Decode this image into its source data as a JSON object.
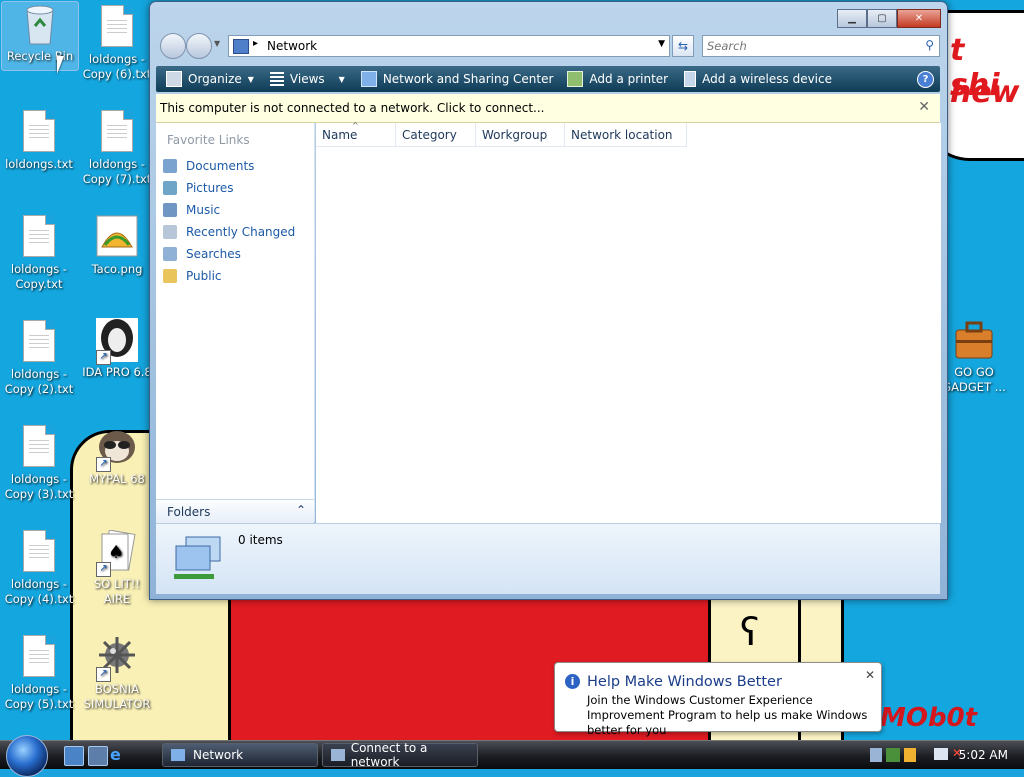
{
  "desktop": {
    "icons": [
      {
        "label": "Recycle Bin"
      },
      {
        "label": "loldongs - Copy (6).txt"
      },
      {
        "label": "loldongs.txt"
      },
      {
        "label": "loldongs - Copy (7).txt"
      },
      {
        "label": "loldongs - Copy.txt"
      },
      {
        "label": "Taco.png"
      },
      {
        "label": "loldongs - Copy (2).txt"
      },
      {
        "label": "IDA PRO 6.8"
      },
      {
        "label": "loldongs - Copy (3).txt"
      },
      {
        "label": "MYPAL 68"
      },
      {
        "label": "loldongs - Copy (4).txt"
      },
      {
        "label": "SO LIT!! AIRE"
      },
      {
        "label": "loldongs - Copy (5).txt"
      },
      {
        "label": "BOSNIA SIMULATOR"
      },
      {
        "label": "GO GO GADGET ..."
      }
    ],
    "wallpaper_text": [
      "t shi",
      "hew",
      "MOb0t"
    ],
    "colors": {
      "sky": "#14a6df",
      "red": "#e11b22",
      "sand": "#f9f0b5"
    }
  },
  "window": {
    "address": "Network",
    "search_placeholder": "Search",
    "toolbar": {
      "organize": "Organize",
      "views": "Views",
      "network_sharing": "Network and Sharing Center",
      "add_printer": "Add a printer",
      "add_wireless": "Add a wireless device"
    },
    "infobar": "This computer is not connected to a network. Click to connect...",
    "favorite_links_header": "Favorite Links",
    "favorite_links": [
      {
        "label": "Documents",
        "icon": "documents-icon"
      },
      {
        "label": "Pictures",
        "icon": "pictures-icon"
      },
      {
        "label": "Music",
        "icon": "music-icon"
      },
      {
        "label": "Recently Changed",
        "icon": "recent-icon"
      },
      {
        "label": "Searches",
        "icon": "searches-icon"
      },
      {
        "label": "Public",
        "icon": "folder-icon"
      }
    ],
    "folders_label": "Folders",
    "columns": [
      "Name",
      "Category",
      "Workgroup",
      "Network location"
    ],
    "item_count": "0 items"
  },
  "notification": {
    "title": "Help Make Windows Better",
    "body": "Join the Windows Customer Experience Improvement Program to help us make Windows better for you"
  },
  "taskbar": {
    "buttons": [
      "Network",
      "Connect to a network"
    ],
    "clock": "5:02 AM"
  }
}
